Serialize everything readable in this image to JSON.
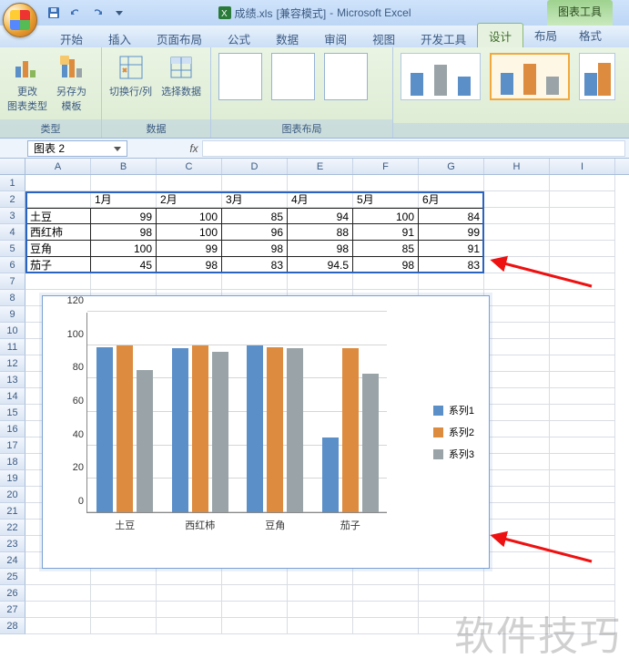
{
  "window": {
    "filename": "成绩.xls",
    "compat": "[兼容模式]",
    "app": "Microsoft Excel",
    "tool_context": "图表工具"
  },
  "tabs": {
    "main": [
      "开始",
      "插入",
      "页面布局",
      "公式",
      "数据",
      "审阅",
      "视图",
      "开发工具"
    ],
    "context": [
      "设计",
      "布局",
      "格式"
    ],
    "active": "设计"
  },
  "ribbon": {
    "group_type": "类型",
    "group_data": "数据",
    "group_layout": "图表布局",
    "btn_change_type": "更改\n图表类型",
    "btn_save_template": "另存为\n模板",
    "btn_switch_rc": "切换行/列",
    "btn_select_data": "选择数据"
  },
  "namebox": "图表 2",
  "columns": [
    "A",
    "B",
    "C",
    "D",
    "E",
    "F",
    "G",
    "H",
    "I"
  ],
  "row_numbers": [
    1,
    2,
    3,
    4,
    5,
    6,
    7,
    8,
    9,
    10,
    11,
    12,
    13,
    14,
    15,
    16,
    17,
    18,
    19,
    20,
    21,
    22,
    23,
    24,
    25,
    26,
    27,
    28
  ],
  "table": {
    "months": [
      "1月",
      "2月",
      "3月",
      "4月",
      "5月",
      "6月"
    ],
    "rows": [
      {
        "name": "土豆",
        "vals": [
          99,
          100,
          85,
          94,
          100,
          84
        ]
      },
      {
        "name": "西红柿",
        "vals": [
          98,
          100,
          96,
          88,
          91,
          99
        ]
      },
      {
        "name": "豆角",
        "vals": [
          100,
          99,
          98,
          98,
          85,
          91
        ]
      },
      {
        "name": "茄子",
        "vals": [
          45,
          98,
          83,
          94.5,
          98,
          83
        ]
      }
    ]
  },
  "chart_data": {
    "type": "bar",
    "categories": [
      "土豆",
      "西红柿",
      "豆角",
      "茄子"
    ],
    "series": [
      {
        "name": "系列1",
        "values": [
          99,
          98,
          100,
          45
        ],
        "color": "#5b8fc8"
      },
      {
        "name": "系列2",
        "values": [
          100,
          100,
          99,
          98
        ],
        "color": "#dd8b3e"
      },
      {
        "name": "系列3",
        "values": [
          85,
          96,
          98,
          83
        ],
        "color": "#9aa4a8"
      }
    ],
    "yticks": [
      0,
      20,
      40,
      60,
      80,
      100,
      120
    ],
    "ylim": [
      0,
      120
    ],
    "legend_labels": [
      "系列1",
      "系列2",
      "系列3"
    ]
  },
  "watermark": "软件技巧"
}
